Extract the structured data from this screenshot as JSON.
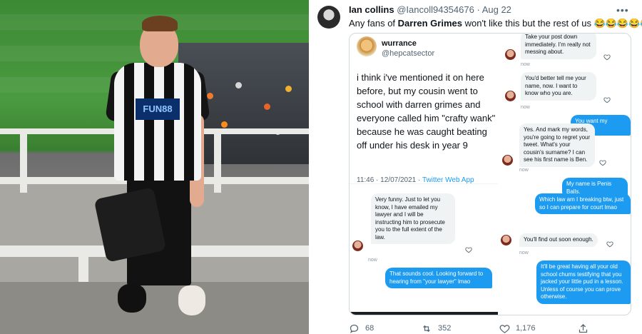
{
  "tweet": {
    "author_name": "Ian collins",
    "author_handle": "@Iancoll94354676",
    "separator": "·",
    "date": "Aug 22",
    "text_before": "Any fans of ",
    "text_bold": "Darren Grimes",
    "text_after": " won't like this but the rest of us 😂😂😂😂😂",
    "more_icon": "more-icon"
  },
  "quoted_tweet": {
    "name": "wurrance",
    "handle": "@hepcatsector",
    "body": "i think i've mentioned it on here before, but my cousin went to school with darren grimes and everyone called him \"crafty wank\" because he was caught beating off under his desk in year 9",
    "timestamp": "11:46 · 12/07/2021 · ",
    "source": "Twitter Web App"
  },
  "dm_left": [
    {
      "side": "in",
      "text": "Very funny. Just to let you know, I have emailed my lawyer and I will be instructing him to prosecute you to the full extent of the law."
    },
    {
      "side": "out",
      "text": "That sounds cool. Looking forward to hearing from \"your lawyer\" lmao"
    }
  ],
  "dm_right": [
    {
      "side": "in",
      "text": "Take your post down immediately. I'm really not messing about."
    },
    {
      "side": "in",
      "text": "You'd better tell me your name, now. I want to know who you are."
    },
    {
      "side": "out",
      "text": "You want my name?"
    },
    {
      "side": "in",
      "text": "Yes. And mark my words, you're going to regret your tweet. What's your cousin's surname? I can see his first name is Ben."
    },
    {
      "side": "out",
      "text": "My name is Penis Balls."
    },
    {
      "side": "out",
      "text": "Which law am I breaking btw, just so I can prepare for court lmao"
    },
    {
      "side": "in",
      "text": "You'll find out soon enough."
    },
    {
      "side": "out",
      "text": "It'll be great having all your old school chums testifying that you jacked your little pud in a lesson. Unless of course you can prove otherwise."
    }
  ],
  "dm_timestamp": "now",
  "photo": {
    "shirt_sponsor": "FUN88"
  },
  "actions": {
    "replies": "68",
    "retweets": "352",
    "likes": "1,176"
  },
  "colors": {
    "accent": "#1d9bf0",
    "text_secondary": "#536471"
  }
}
